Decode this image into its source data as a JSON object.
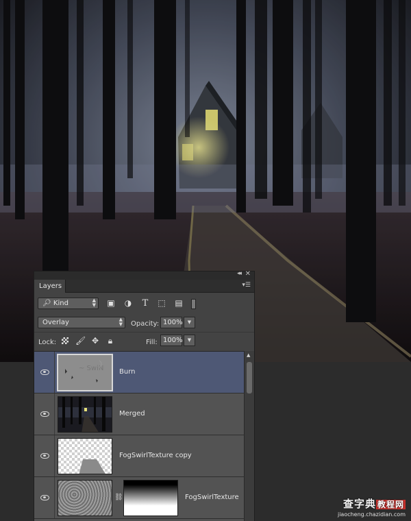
{
  "panel": {
    "tab_label": "Layers",
    "collapse_icon": "double-chevron-icon",
    "close_icon": "close-icon",
    "menu_icon": "panel-menu-icon"
  },
  "filter": {
    "kind_value": "Kind",
    "icons": [
      "image-filter-icon",
      "adjustment-filter-icon",
      "type-filter-icon",
      "shape-filter-icon",
      "smart-object-filter-icon"
    ],
    "type_glyph": "T"
  },
  "blend": {
    "mode_value": "Overlay",
    "opacity_label": "Opacity:",
    "opacity_value": "100%"
  },
  "lock": {
    "label": "Lock:",
    "fill_label": "Fill:",
    "fill_value": "100%"
  },
  "layers": [
    {
      "name": "Burn",
      "selected": true,
      "visible": true
    },
    {
      "name": "Merged",
      "selected": false,
      "visible": true
    },
    {
      "name": "FogSwirlTexture copy",
      "selected": false,
      "visible": true
    },
    {
      "name": "FogSwirlTexture",
      "selected": false,
      "visible": true,
      "has_mask": true
    }
  ],
  "watermark": {
    "title_a": "查字典",
    "title_b": "教程网",
    "url": "jiaocheng.chazidian.com"
  }
}
